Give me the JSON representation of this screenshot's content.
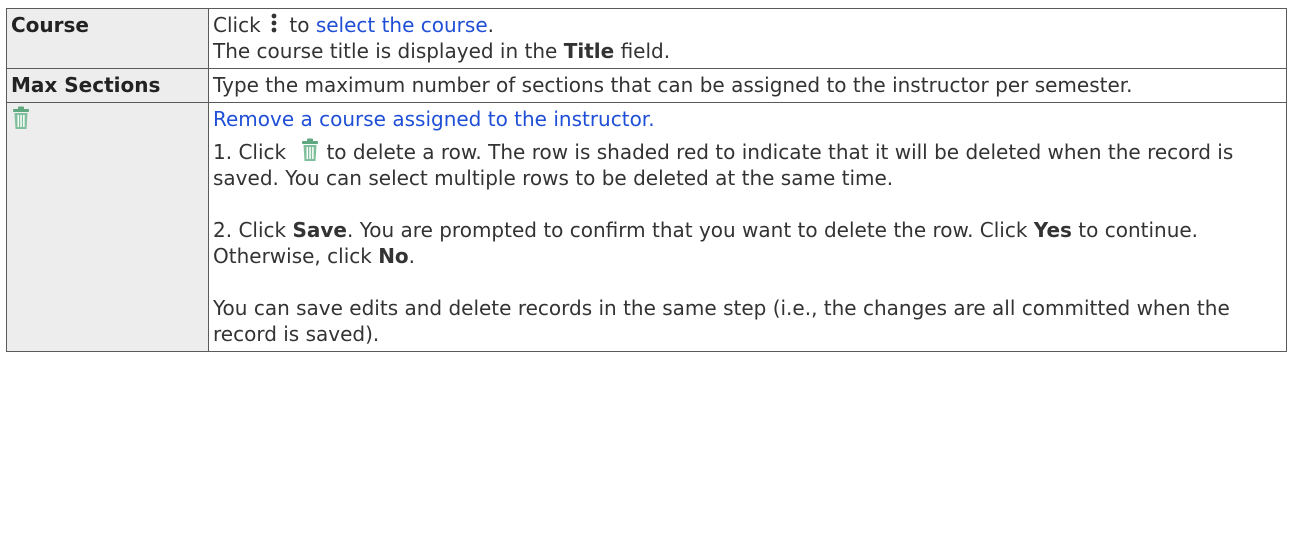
{
  "rows": [
    {
      "term": "Course",
      "line1_prefix": "Click",
      "line1_mid": "to",
      "line1_link": "select the course",
      "line1_end": ".",
      "line2_prefix": "The course title is displayed in the",
      "line2_bold": "Title",
      "line2_suffix": "field."
    },
    {
      "term": "Max Sections",
      "desc": "Type the maximum number of sections that can be assigned to the instructor per semester."
    },
    {
      "term_icon": "trash-icon",
      "link": "Remove a course assigned to the instructor.",
      "step1_prefix": "1. Click",
      "step1_suffix": "to delete a row. The row is shaded red to indicate that it will be deleted when the record is saved. You can select multiple rows to be deleted at the same time.",
      "step2_prefix": "2. Click",
      "step2_bold_save": "Save",
      "step2_mid": ". You are prompted to confirm that you want to delete the row. Click",
      "step2_bold_yes": "Yes",
      "step2_mid2": "to continue. Otherwise, click",
      "step2_bold_no": "No",
      "step2_end": ".",
      "note": "You can save edits and delete records in the same step (i.e., the changes are all committed when the record is saved)."
    }
  ],
  "colors": {
    "link": "#1f4fd6",
    "term_bg": "#ededed",
    "icon": "#5fa880",
    "border": "#5a5a5a"
  }
}
